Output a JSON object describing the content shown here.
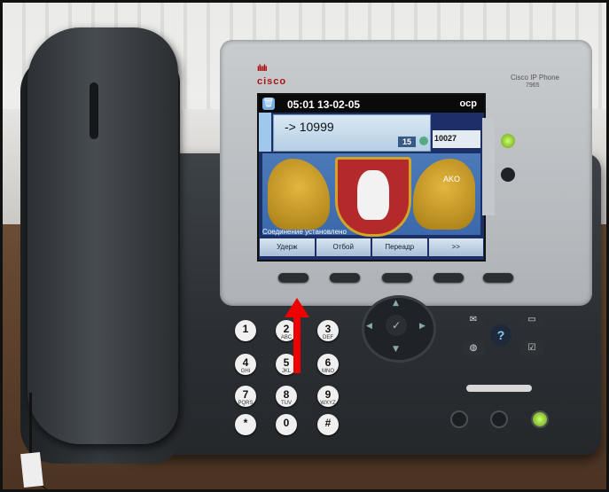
{
  "phone": {
    "brand": "cisco",
    "model_line1": "Cisco IP Phone",
    "model_line2": "7965"
  },
  "screen": {
    "time_date": "05:01 13-02-05",
    "status": "ocp",
    "dialed_number": "-> 10999",
    "call_timer": "15",
    "line_button": "10027",
    "side_label": "AKO",
    "status_line": "Соединение установлено",
    "softkeys": [
      "Удерж",
      "Отбой",
      "Переадр",
      ">>"
    ]
  },
  "keypad": [
    {
      "digit": "1",
      "letters": ""
    },
    {
      "digit": "2",
      "letters": "ABC"
    },
    {
      "digit": "3",
      "letters": "DEF"
    },
    {
      "digit": "4",
      "letters": "GHI"
    },
    {
      "digit": "5",
      "letters": "JKL"
    },
    {
      "digit": "6",
      "letters": "MNO"
    },
    {
      "digit": "7",
      "letters": "PQRS"
    },
    {
      "digit": "8",
      "letters": "TUV"
    },
    {
      "digit": "9",
      "letters": "WXYZ"
    },
    {
      "digit": "*",
      "letters": ""
    },
    {
      "digit": "0",
      "letters": ""
    },
    {
      "digit": "#",
      "letters": ""
    }
  ],
  "colors": {
    "annotation_arrow": "#ee0000",
    "led_active": "#9ad63a",
    "screen_bg": "#1c2f66"
  },
  "icons": [
    "messages-icon",
    "directories-icon",
    "services-icon",
    "settings-icon",
    "help-icon",
    "speaker-icon",
    "mute-icon",
    "headset-icon",
    "navigation-select-icon"
  ]
}
